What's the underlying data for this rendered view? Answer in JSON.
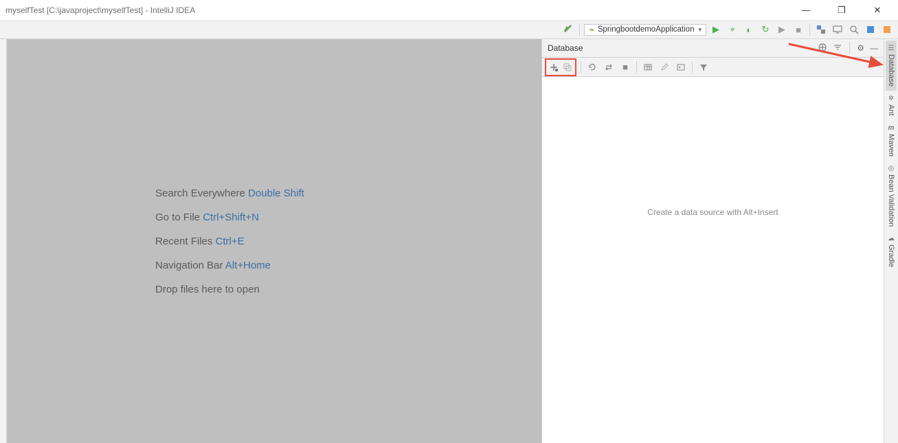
{
  "window": {
    "title": "myselfTest [C:\\javaproject\\myselfTest] - IntelliJ IDEA"
  },
  "toolbar": {
    "run_config": "SpringbootdemoApplication"
  },
  "editor_hints": [
    {
      "label": "Search Everywhere",
      "shortcut": "Double Shift"
    },
    {
      "label": "Go to File",
      "shortcut": "Ctrl+Shift+N"
    },
    {
      "label": "Recent Files",
      "shortcut": "Ctrl+E"
    },
    {
      "label": "Navigation Bar",
      "shortcut": "Alt+Home"
    },
    {
      "label": "Drop files here to open",
      "shortcut": ""
    }
  ],
  "database_panel": {
    "title": "Database",
    "hint": "Create a data source with Alt+Insert"
  },
  "right_tabs": {
    "t0": "Database",
    "t1": "Ant",
    "t2": "Maven",
    "t3": "Bean Validation",
    "t4": "Gradle"
  }
}
